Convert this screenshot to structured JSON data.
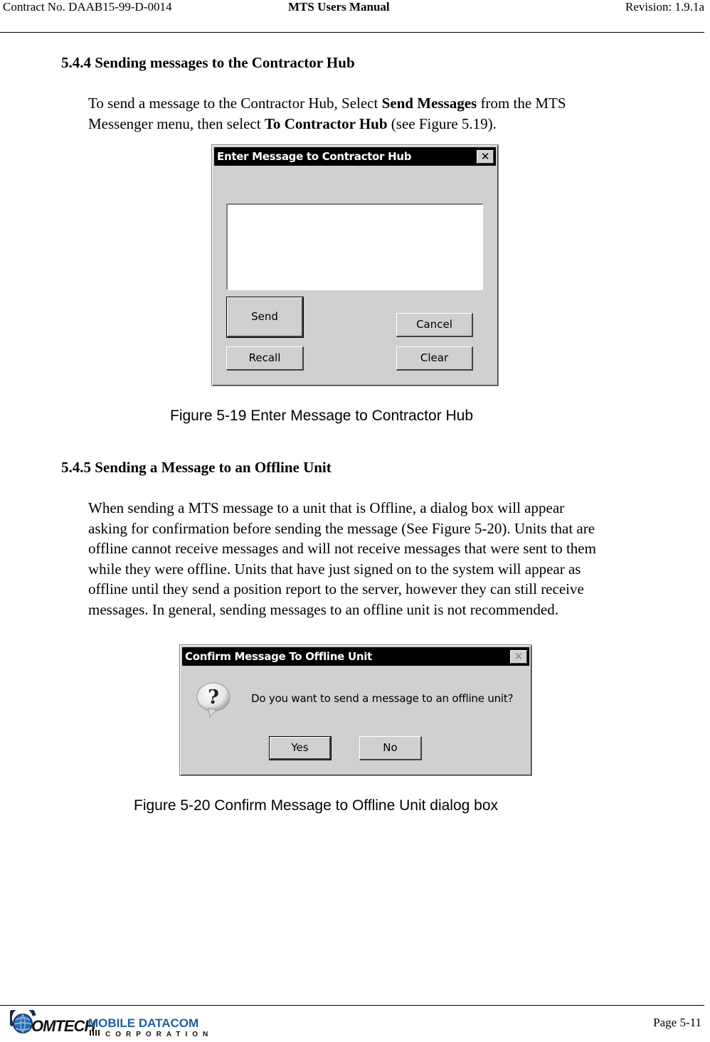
{
  "header": {
    "contract": "Contract No. DAAB15-99-D-0014",
    "title": "MTS Users Manual",
    "revision": "Revision:  1.9.1a"
  },
  "section_544": {
    "heading": "5.4.4  Sending messages to the Contractor Hub",
    "para": {
      "t1": "To send a message to the Contractor Hub, Select ",
      "b1": "Send Messages",
      "t2": " from the MTS",
      "t3": "Messenger menu, then select ",
      "b2": "To Contractor Hub",
      "t4": " (see Figure 5.19)."
    }
  },
  "figure_519": {
    "dialog": {
      "title": "Enter Message to Contractor Hub",
      "close_glyph": "✕",
      "message_value": "",
      "buttons": {
        "send": "Send",
        "cancel": "Cancel",
        "recall": "Recall",
        "clear": "Clear"
      }
    },
    "caption": "Figure 5-19   Enter Message to Contractor Hub"
  },
  "section_545": {
    "heading": "5.4.5  Sending a Message to an Offline Unit",
    "lines": [
      "When sending a MTS message to a unit that is Offline, a dialog box will appear",
      "asking for confirmation before sending the message (See Figure 5-20).  Units that are",
      "offline cannot receive messages and will not receive messages that were sent to them",
      "while they were offline.  Units that have just signed on to the system will appear as",
      "offline until they send a position report to the server, however they can still receive",
      "messages.  In general, sending messages to an offline unit is not recommended."
    ]
  },
  "figure_520": {
    "dialog": {
      "title": "Confirm Message To Offline Unit",
      "close_glyph": "✕",
      "icon": "question-icon",
      "message": "Do you want to send a message to an offline unit?",
      "buttons": {
        "yes": "Yes",
        "no": "No"
      }
    },
    "caption": "Figure 5-20    Confirm Message to Offline Unit dialog box"
  },
  "footer": {
    "logo": {
      "brand": "OMTECH",
      "brand_initial": "C",
      "line1": "MOBILE DATACOM",
      "line2": "CORPORATION",
      "color": "#1f5fa0"
    },
    "page": "Page 5-11"
  }
}
